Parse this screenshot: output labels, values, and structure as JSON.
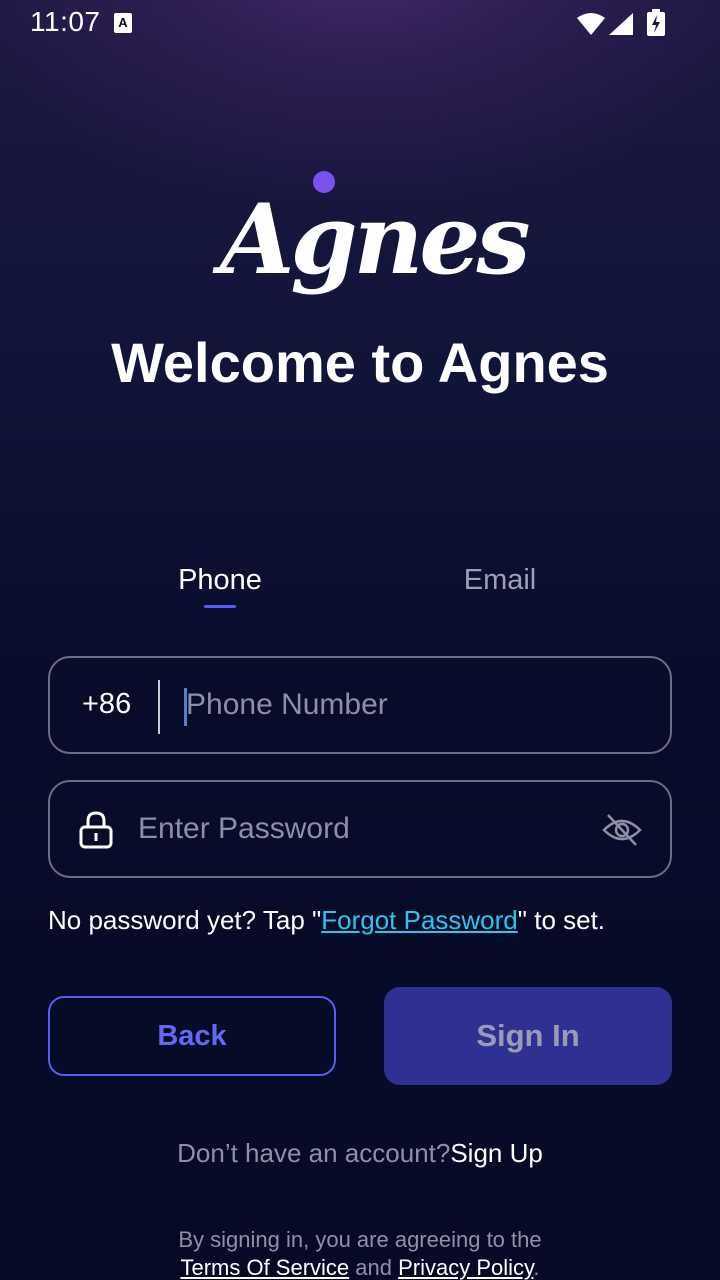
{
  "status_bar": {
    "time": "11:07"
  },
  "logo": {
    "text": "Agnes"
  },
  "welcome_title": "Welcome to Agnes",
  "tabs": [
    {
      "label": "Phone",
      "active": true
    },
    {
      "label": "Email",
      "active": false
    }
  ],
  "phone_field": {
    "country_code": "+86",
    "placeholder": "Phone Number",
    "value": ""
  },
  "password_field": {
    "placeholder": "Enter Password",
    "value": ""
  },
  "hint": {
    "prefix": "No password yet? Tap \"",
    "link": "Forgot Password",
    "suffix": "\" to set."
  },
  "buttons": {
    "back": "Back",
    "sign_in": "Sign In"
  },
  "signup": {
    "question": "Don’t have an account?",
    "link": "Sign Up"
  },
  "legal": {
    "line1": "By signing in, you are agreeing to the",
    "terms": "Terms Of Service",
    "and": "and",
    "privacy": "Privacy Policy",
    "end": "."
  },
  "colors": {
    "accent": "#5a5ef0",
    "link": "#2fc4f0",
    "signin_bg": "#2f3192",
    "logo_dot": "#7b52f0"
  }
}
